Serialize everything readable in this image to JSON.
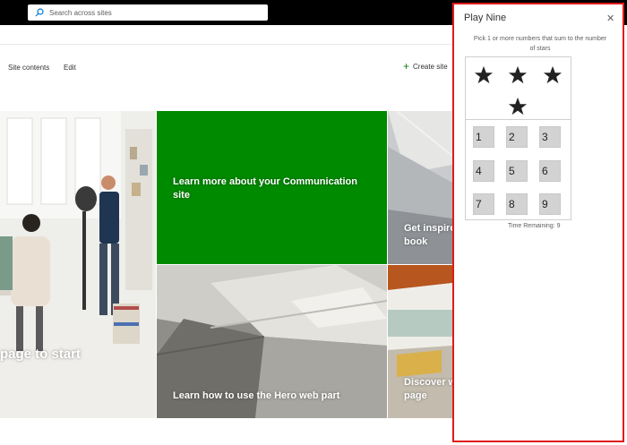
{
  "suite_bar": {
    "search_placeholder": "Search across sites"
  },
  "command_bar": {
    "site_contents": "Site contents",
    "edit": "Edit",
    "create_site": "Create site"
  },
  "hero": {
    "office_caption": "page to start",
    "green_caption": "Learn more about your Communication site",
    "arch_top_caption": "Get inspire book",
    "arch_bottom_caption": "Learn how to use the Hero web part",
    "building_caption": "Discover w page"
  },
  "panel": {
    "title": "Play Nine",
    "instructions": "Pick 1 or more numbers that sum to the number of stars",
    "star_count": 4,
    "numbers": [
      "1",
      "2",
      "3",
      "4",
      "5",
      "6",
      "7",
      "8",
      "9"
    ],
    "time_remaining": "Time Remaining: 9"
  },
  "colors": {
    "accent_green": "#008a00",
    "panel_border": "#e11a1a"
  }
}
